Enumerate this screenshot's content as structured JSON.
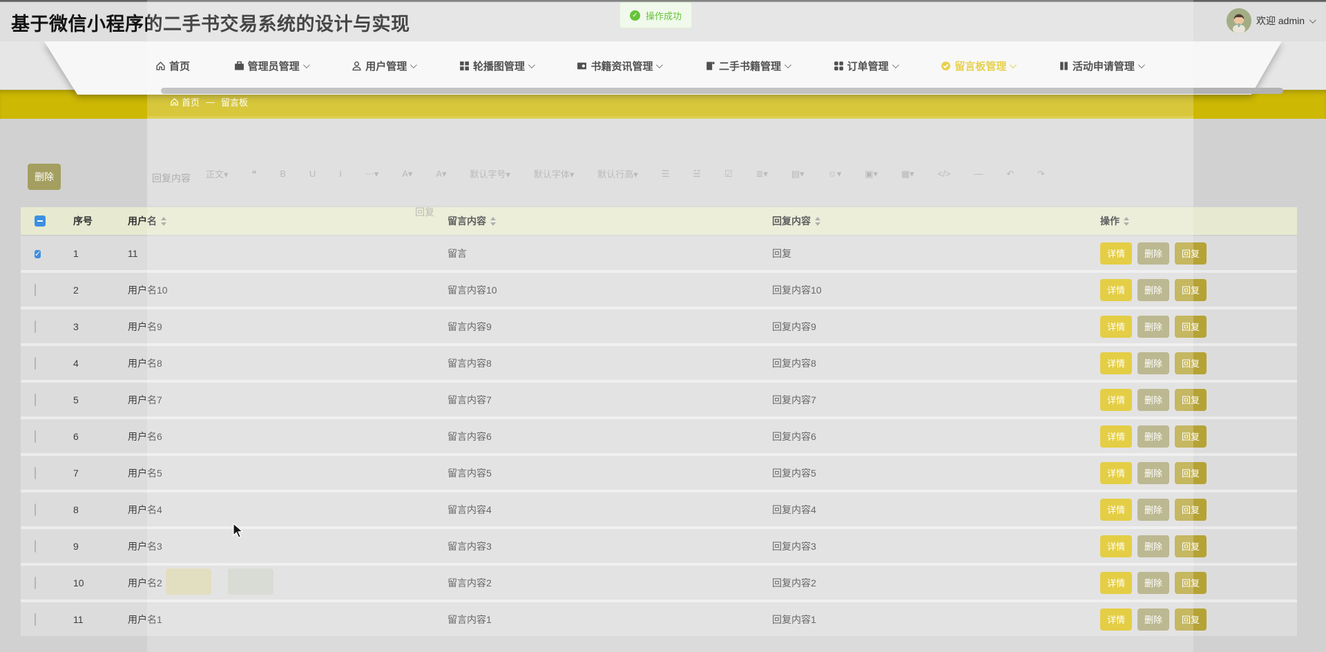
{
  "app": {
    "title": "基于微信小程序的二手书交易系统的设计与实现",
    "welcome": "欢迎 admin",
    "toast": "操作成功"
  },
  "nav": {
    "items": [
      {
        "label": "首页",
        "icon": "home-icon",
        "dropdown": false,
        "active": false
      },
      {
        "label": "管理员管理",
        "icon": "briefcase-icon",
        "dropdown": true,
        "active": false
      },
      {
        "label": "用户管理",
        "icon": "user-icon",
        "dropdown": true,
        "active": false
      },
      {
        "label": "轮播图管理",
        "icon": "grid-icon",
        "dropdown": true,
        "active": false
      },
      {
        "label": "书籍资讯管理",
        "icon": "news-icon",
        "dropdown": true,
        "active": false
      },
      {
        "label": "二手书籍管理",
        "icon": "book-icon",
        "dropdown": true,
        "active": false
      },
      {
        "label": "订单管理",
        "icon": "orders-icon",
        "dropdown": true,
        "active": false
      },
      {
        "label": "留言板管理",
        "icon": "message-icon",
        "dropdown": true,
        "active": true
      },
      {
        "label": "活动申请管理",
        "icon": "activity-icon",
        "dropdown": true,
        "active": false
      }
    ]
  },
  "breadcrumb": {
    "home": "首页",
    "separator": "—",
    "current": "留言板"
  },
  "actions_bar": {
    "delete_label": "删除"
  },
  "faded_dialog": {
    "title": "回复",
    "field_label": "回复内容",
    "editor_buttons": [
      "正文▾",
      "❝",
      "B",
      "U",
      "I",
      "⋯▾",
      "A▾",
      "A▾",
      "默认字号▾",
      "默认字体▾",
      "默认行高▾",
      "☰",
      "☱",
      "☑",
      "≣▾",
      "▤▾",
      "☺▾",
      "▣▾",
      "▦▾",
      "</>",
      "―",
      "↶",
      "↷"
    ]
  },
  "table": {
    "headers": [
      {
        "label": "",
        "sortable": false
      },
      {
        "label": "序号",
        "sortable": false
      },
      {
        "label": "用户名",
        "sortable": true
      },
      {
        "label": "留言内容",
        "sortable": true
      },
      {
        "label": "回复内容",
        "sortable": true
      },
      {
        "label": "操作",
        "sortable": true
      }
    ],
    "row_actions": [
      "详情",
      "删除",
      "回复"
    ],
    "rows": [
      {
        "checked": true,
        "index": "1",
        "username": "11",
        "message": "留言",
        "reply": "回复"
      },
      {
        "checked": false,
        "index": "2",
        "username": "用户名10",
        "message": "留言内容10",
        "reply": "回复内容10"
      },
      {
        "checked": false,
        "index": "3",
        "username": "用户名9",
        "message": "留言内容9",
        "reply": "回复内容9"
      },
      {
        "checked": false,
        "index": "4",
        "username": "用户名8",
        "message": "留言内容8",
        "reply": "回复内容8"
      },
      {
        "checked": false,
        "index": "5",
        "username": "用户名7",
        "message": "留言内容7",
        "reply": "回复内容7"
      },
      {
        "checked": false,
        "index": "6",
        "username": "用户名6",
        "message": "留言内容6",
        "reply": "回复内容6"
      },
      {
        "checked": false,
        "index": "7",
        "username": "用户名5",
        "message": "留言内容5",
        "reply": "回复内容5"
      },
      {
        "checked": false,
        "index": "8",
        "username": "用户名4",
        "message": "留言内容4",
        "reply": "回复内容4"
      },
      {
        "checked": false,
        "index": "9",
        "username": "用户名3",
        "message": "留言内容3",
        "reply": "回复内容3"
      },
      {
        "checked": false,
        "index": "10",
        "username": "用户名2",
        "message": "留言内容2",
        "reply": "回复内容2"
      },
      {
        "checked": false,
        "index": "11",
        "username": "用户名1",
        "message": "留言内容1",
        "reply": "回复内容1"
      }
    ]
  },
  "colors": {
    "accent_yellow": "#cdb804",
    "nav_active_yellow": "#dfc41e",
    "success_green": "#67c23a",
    "checkbox_blue": "#3d8fe0",
    "btn_detail": "#ddc011",
    "btn_delete": "#aaa572",
    "btn_reply": "#b6a335",
    "bulk_delete": "#a49f60"
  }
}
